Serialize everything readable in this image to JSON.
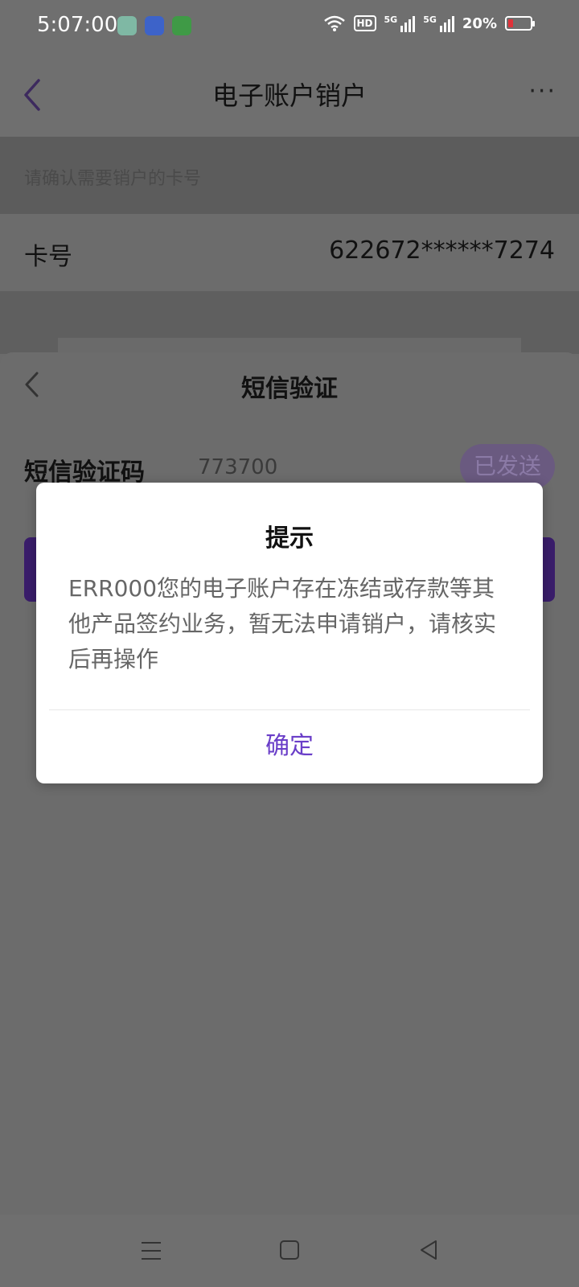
{
  "status_bar": {
    "time": "5:07:00",
    "hd_label": "HD",
    "network1": "5G",
    "network2": "5G",
    "battery": "20%"
  },
  "header": {
    "title": "电子账户销户",
    "more": "···"
  },
  "page": {
    "hint": "请确认需要销户的卡号",
    "card_label": "卡号",
    "card_number": "622672******7274"
  },
  "sheet": {
    "title": "短信验证",
    "code_label": "短信验证码",
    "code_value": "773700",
    "sent_label": "已发送"
  },
  "dialog": {
    "title": "提示",
    "message": "ERR000您的电子账户存在冻结或存款等其他产品签约业务，暂无法申请销户，请核实后再操作",
    "confirm": "确定"
  },
  "colors": {
    "accent": "#6a3ec8",
    "overlay": "#6b6b6b"
  }
}
